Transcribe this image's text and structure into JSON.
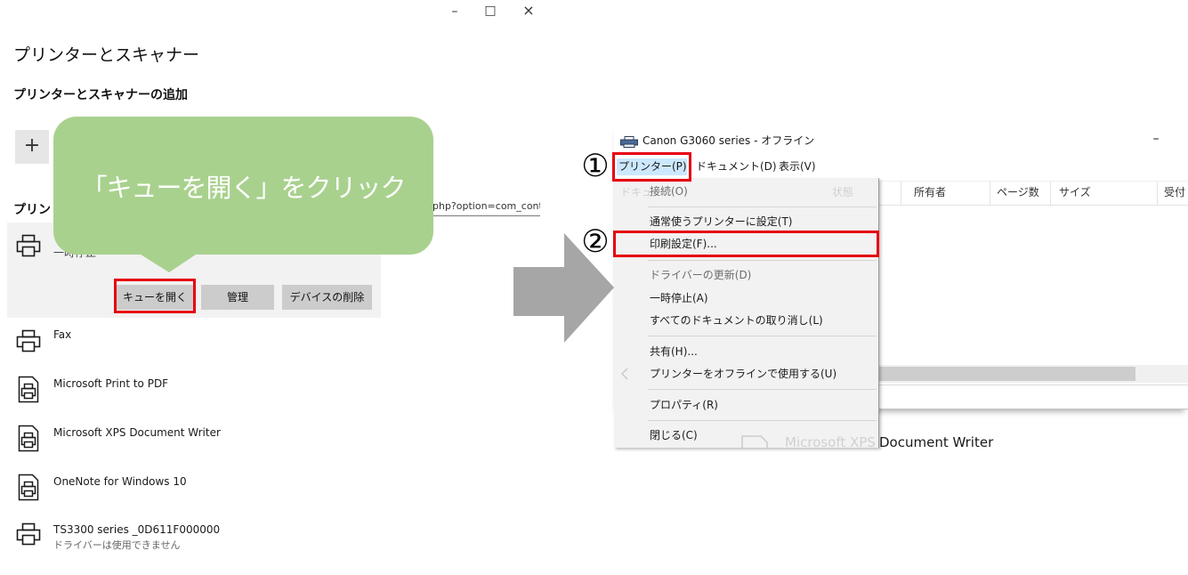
{
  "settings_window": {
    "window_controls": {
      "minimize": "–",
      "maximize": "□",
      "close": "×"
    },
    "title": "プリンターとスキャナー",
    "add_section_title": "プリンターとスキャナーの追加",
    "add_button": "+",
    "printers_section_title": "プリン",
    "search_field_value": "php?option=com_conten",
    "selected_printer": {
      "status": "一時停止",
      "actions": {
        "open_queue": "キューを開く",
        "manage": "管理",
        "remove_device": "デバイスの削除"
      }
    },
    "printers": [
      {
        "name": "Fax",
        "icon": "printer-icon"
      },
      {
        "name": "Microsoft Print to PDF",
        "icon": "document-printer-icon"
      },
      {
        "name": "Microsoft XPS Document Writer",
        "icon": "document-printer-icon"
      },
      {
        "name": "OneNote for Windows 10",
        "icon": "document-printer-icon"
      },
      {
        "name": "TS3300 series _0D611F000000",
        "status": "ドライバーは使用できません",
        "icon": "printer-icon"
      }
    ]
  },
  "callout": {
    "text": "「キューを開く」をクリック"
  },
  "step_markers": {
    "step1": "①",
    "step2": "②"
  },
  "queue_window": {
    "title": "Canon G3060 series - オフライン",
    "minimize": "–",
    "menubar": [
      {
        "label": "プリンター(P)",
        "active": true
      },
      {
        "label": "ドキュメント(D)"
      },
      {
        "label": "表示(V)"
      }
    ],
    "columns": [
      "ドキュ",
      "状態",
      "所有者",
      "ページ数",
      "サイズ",
      "受付"
    ],
    "printer_menu": [
      {
        "label": "接続(O)",
        "disabled": true
      },
      {
        "label": "通常使うプリンターに設定(T)"
      },
      {
        "label": "印刷設定(F)...",
        "highlighted": true
      },
      {
        "label": "ドライバーの更新(D)",
        "disabled": true
      },
      {
        "label": "一時停止(A)"
      },
      {
        "label": "すべてのドキュメントの取り消し(L)"
      },
      {
        "label": "共有(H)..."
      },
      {
        "label": "プリンターをオフラインで使用する(U)"
      },
      {
        "label": "プロパティ(R)"
      },
      {
        "label": "閉じる(C)"
      }
    ]
  },
  "background_text": {
    "faded": "Microsoft XPS",
    "visible": "Document Writer"
  },
  "colors": {
    "callout": "#a9d18e",
    "highlight": "#e60012",
    "arrow": "#a6a6a6",
    "menu_active": "#cce8ff"
  }
}
